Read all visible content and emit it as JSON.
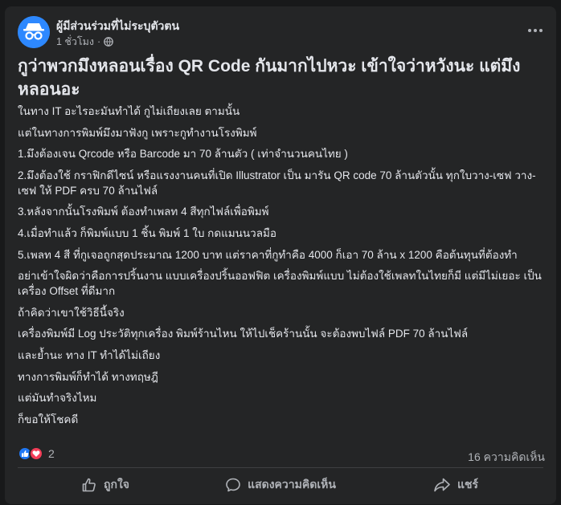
{
  "post": {
    "author": "ผู้มีส่วนร่วมที่ไม่ระบุตัวตน",
    "time": "1 ชั่วโมง",
    "separator": "·",
    "title": "กูว่าพวกมึงหลอนเรื่อง QR Code กันมากไปหวะ เข้าใจว่าหวังนะ แต่มึงหลอนอะ",
    "paragraphs": [
      "ในทาง IT อะไรอะมันทำได้ กูไม่เถียงเลย ตามนั้น",
      "แต่ในทางการพิมพ์มึงมาฟังกู เพราะกูทำงานโรงพิมพ์",
      "1.มึงต้องเจน Qrcode หรือ Barcode มา 70 ล้านตัว ( เท่าจำนวนคนไทย )",
      "2.มึงต้องใช้ กราฟิกดีไซน์ หรือแรงงานคนที่เปิด Illustrator เป็น มารัน QR code 70 ล้านตัวนั้น ทุกใบวาง-เซฟ วาง-เซฟ ให้ PDF ครบ 70 ล้านไฟล์",
      "3.หลังจากนั้นโรงพิมพ์ ต้องทำเพลท 4 สีทุกไฟล์เพื่อพิมพ์",
      "4.เมื่อทำแล้ว ก็พิมพ์แบบ 1 ชิ้น พิมพ์ 1 ใบ กดแมนนวลมือ",
      "5.เพลท 4 สี ที่กูเจอถูกสุดประมาณ 1200 บาท แต่ราคาที่กูทำคือ 4000 ก็เอา 70 ล้าน x 1200 คือต้นทุนที่ต้องทำ",
      "อย่าเข้าใจผิดว่าคือการปริ้นงาน แบบเครื่องปริ้นออฟฟิต เครื่องพิมพ์แบบ ไม่ต้องใช้เพลทในไทยก็มี แต่มีไม่เยอะ เป็นเครื่อง Offset ที่ดีมาก",
      "ถ้าคิดว่าเขาใช้วิธีนี้จริง",
      "เครื่องพิมพ์มี Log ประวัติทุกเครื่อง พิมพ์ร้านไหน ให้ไปเช็คร้านนั้น จะต้องพบไฟล์ PDF 70 ล้านไฟล์",
      "และย้ำนะ ทาง IT ทำได้ไม่เถียง",
      "ทางการพิมพ์ก็ทำได้ ทางทฤษฎี",
      "แต่มันทำจริงไหม",
      "ก็ขอให้โชคดี"
    ],
    "reaction_count": "2",
    "comment_count": "16 ความคิดเห็น"
  },
  "actions": {
    "like": "ถูกใจ",
    "comment": "แสดงความคิดเห็น",
    "share": "แชร์"
  },
  "icons": {
    "avatar": "anonymous-incognito-icon",
    "privacy": "globe-icon",
    "more": "ellipsis-icon",
    "like_reaction": "thumbs-up-icon",
    "love_reaction": "heart-icon",
    "like_action": "thumbs-up-outline-icon",
    "comment_action": "speech-bubble-icon",
    "share_action": "share-arrow-icon"
  },
  "colors": {
    "background": "#18191a",
    "card": "#242526",
    "text_primary": "#e4e6eb",
    "text_secondary": "#b0b3b8",
    "like_blue": "#2078f4",
    "love_red": "#f33e58"
  }
}
